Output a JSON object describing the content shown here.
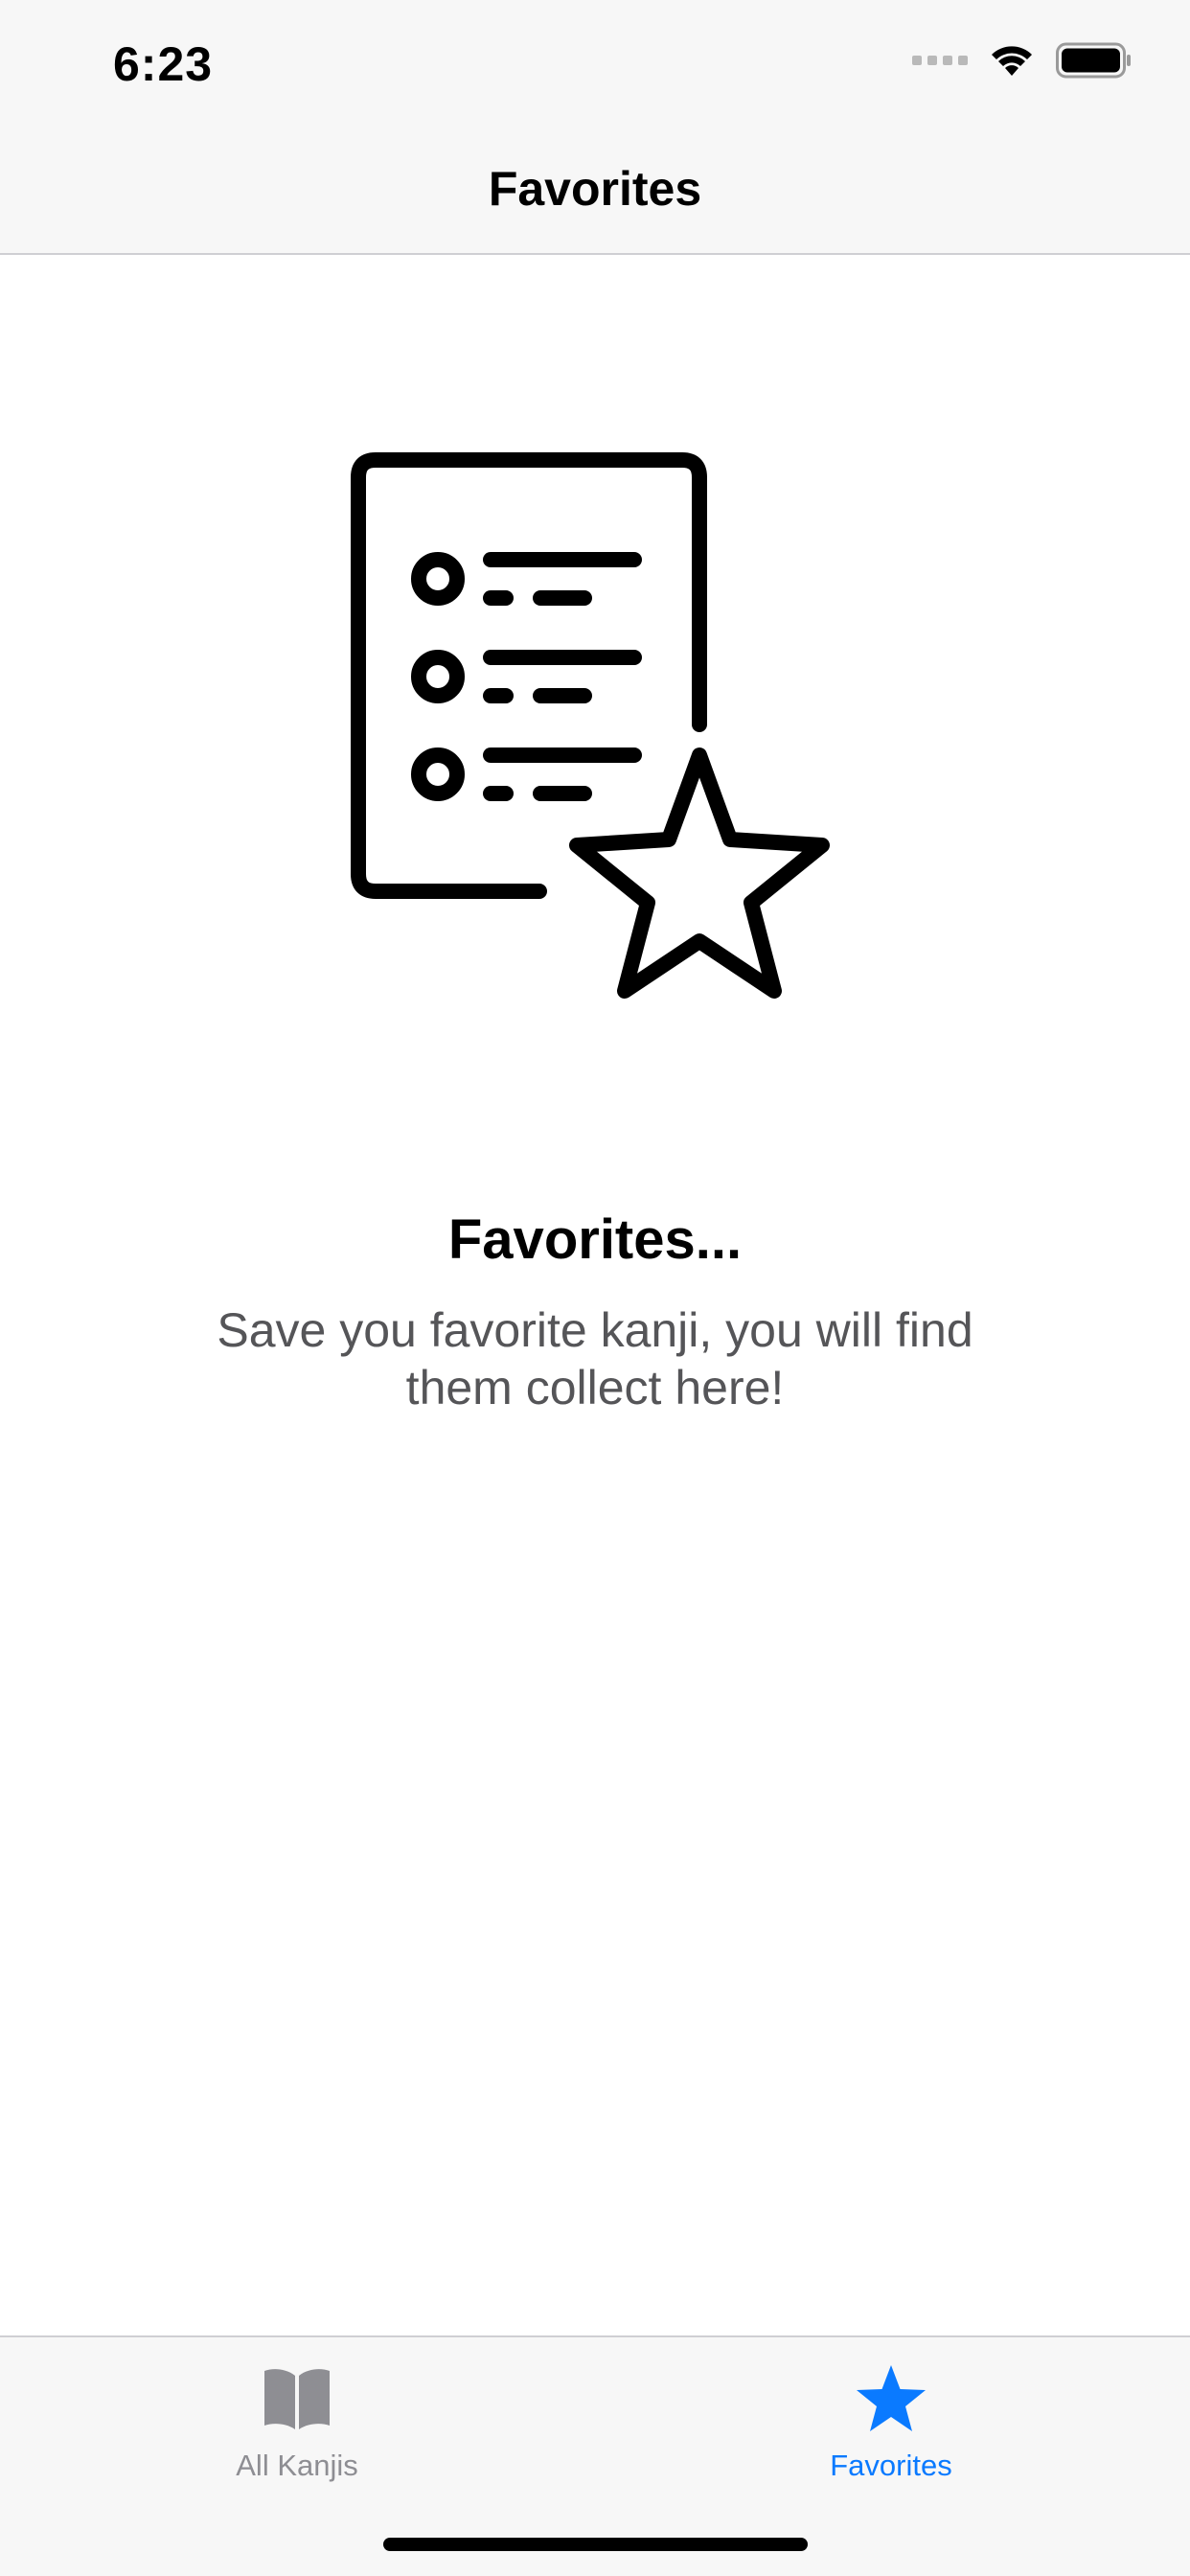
{
  "status_bar": {
    "time": "6:23"
  },
  "nav": {
    "title": "Favorites"
  },
  "empty_state": {
    "icon": "favorites-list-star-icon",
    "title": "Favorites...",
    "subtitle": "Save you favorite kanji, you will find them collect here!"
  },
  "tab_bar": {
    "tabs": [
      {
        "label": "All Kanjis",
        "icon": "book-icon",
        "selected": false
      },
      {
        "label": "Favorites",
        "icon": "star-icon",
        "selected": true
      }
    ]
  },
  "colors": {
    "accent": "#0a7aff",
    "inactive": "#8e8e93",
    "bar_background": "#f7f7f7"
  }
}
